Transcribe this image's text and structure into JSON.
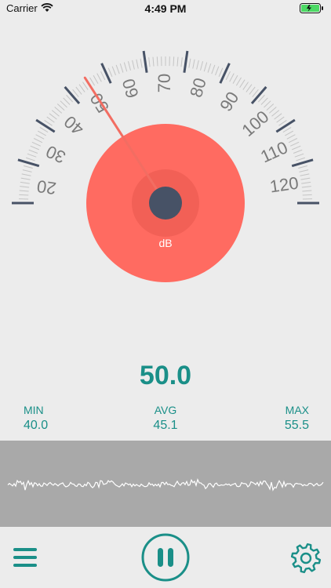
{
  "status_bar": {
    "carrier": "Carrier",
    "time": "4:49 PM"
  },
  "gauge": {
    "scale_labels": [
      "20",
      "30",
      "40",
      "50",
      "60",
      "70",
      "80",
      "90",
      "100",
      "110",
      "120"
    ],
    "unit": "dB",
    "current_level_db": 50.0,
    "needle_color": "#f26d62",
    "disc_color": "#ff6b61",
    "hub_color": "#475266"
  },
  "reading": {
    "value": "50.0"
  },
  "stats": {
    "min": {
      "label": "MIN",
      "value": "40.0"
    },
    "avg": {
      "label": "AVG",
      "value": "45.1"
    },
    "max": {
      "label": "MAX",
      "value": "55.5"
    }
  },
  "colors": {
    "accent": "#1a8f88",
    "background": "#ececec",
    "waveform_bg": "#a9a9a9"
  },
  "toolbar": {
    "menu_icon": "hamburger-menu-icon",
    "pause_icon": "pause-icon",
    "settings_icon": "gear-icon"
  }
}
